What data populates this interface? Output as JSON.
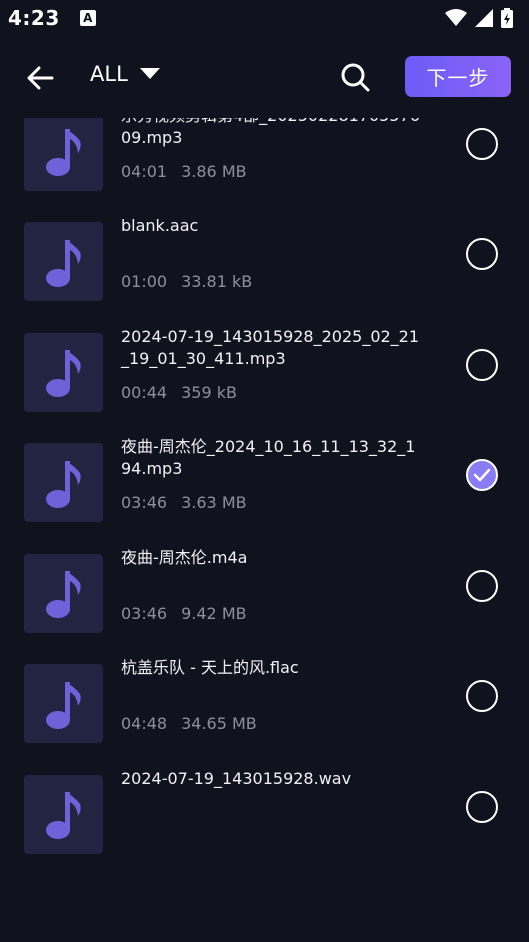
{
  "status": {
    "time": "4:23",
    "notif_glyph": "A"
  },
  "header": {
    "filter_label": "ALL",
    "next_label": "下一步"
  },
  "colors": {
    "accent": "#7a60f6",
    "thumb_bg": "#232442",
    "bg": "#10121d",
    "note": "#6d62d8"
  },
  "files": [
    {
      "name": "blank.aac",
      "duration": "01:00",
      "size": "33.81 kB",
      "checked": false
    },
    {
      "name": "乐秀视频剪辑第4部_20250228170557609.mp3",
      "duration": "04:01",
      "size": "3.86 MB",
      "checked": false
    },
    {
      "name": "blank.aac",
      "duration": "01:00",
      "size": "33.81 kB",
      "checked": false
    },
    {
      "name": "2024-07-19_143015928_2025_02_21_19_01_30_411.mp3",
      "duration": "00:44",
      "size": "359 kB",
      "checked": false
    },
    {
      "name": "夜曲-周杰伦_2024_10_16_11_13_32_194.mp3",
      "duration": "03:46",
      "size": "3.63 MB",
      "checked": true
    },
    {
      "name": "夜曲-周杰伦.m4a",
      "duration": "03:46",
      "size": "9.42 MB",
      "checked": false
    },
    {
      "name": "杭盖乐队 - 天上的风.flac",
      "duration": "04:48",
      "size": "34.65 MB",
      "checked": false
    },
    {
      "name": "2024-07-19_143015928.wav",
      "duration": "",
      "size": "",
      "checked": false
    }
  ]
}
